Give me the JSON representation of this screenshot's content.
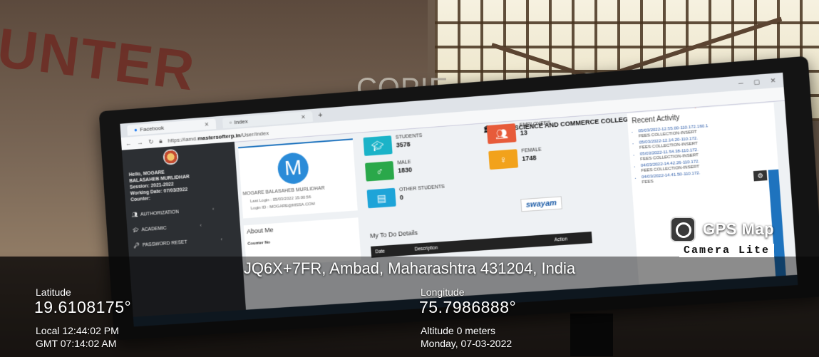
{
  "photo": {
    "wall_sign": "UNTER",
    "wall_sign_2": "COPIE"
  },
  "browser": {
    "tabs": [
      "Facebook",
      "Index"
    ],
    "url_prefix": "https://iamd.",
    "url_domain": "mastersofterp.in",
    "url_path": "/User/Index"
  },
  "app": {
    "college_name": "ARTS,SCIENCE AND COMMERCE COLLEGE, AMBAD",
    "sidebar": {
      "hello": "Hello, MOGARE",
      "user": "BALASAHEB MURLIDHAR",
      "session": "Session: 2021-2022",
      "working_date": "Working Date: 07/03/2022",
      "counter": "Counter:",
      "items": [
        {
          "label": "AUTHORIZATION"
        },
        {
          "label": "ACADEMIC"
        },
        {
          "label": "PASSWORD RESET"
        }
      ]
    },
    "profile": {
      "avatar_letter": "M",
      "name": "MOGARE BALASAHEB MURLIDHAR",
      "last_login": "Last Login : 05/03/2022 15:00:56",
      "login_id": "Login ID : MOGARE@MSSA.COM",
      "about_title": "About Me",
      "counter_no": "Counter No"
    },
    "stats": [
      {
        "label": "STUDENTS",
        "value": "3578",
        "color": "#1bb3c8"
      },
      {
        "label": "EMPLOYEES",
        "value": "13",
        "color": "#e75b3a"
      },
      {
        "label": "MALE",
        "value": "1830",
        "color": "#2aa84a"
      },
      {
        "label": "FEMALE",
        "value": "1748",
        "color": "#f2a21b"
      },
      {
        "label": "OTHER STUDENTS",
        "value": "0",
        "color": "#1ea4d8"
      }
    ],
    "swayam": "swayam",
    "todo": {
      "title": "My To Do Details",
      "columns": [
        "Date",
        "Description",
        "Action"
      ]
    },
    "recent": {
      "title": "Recent Activity",
      "items": [
        {
          "time": "05/03/2022-12.55.00-110.172.160.1",
          "desc": "FEES COLLECTION-INSERT"
        },
        {
          "time": "05/03/2022-12.14.20-110.172.",
          "desc": "FEES COLLECTION-INSERT"
        },
        {
          "time": "05/03/2022-11.54.38-110.172.",
          "desc": "FEES COLLECTION-INSERT"
        },
        {
          "time": "04/03/2022-14.42.26-110.172.",
          "desc": "FEES COLLECTION-INSERT"
        },
        {
          "time": "04/03/2022-14.41.50-110.172.",
          "desc": "FEES"
        }
      ]
    }
  },
  "gps": {
    "brand_title": "GPS Map",
    "brand_sub": "Camera Lite",
    "address": "JQ6X+7FR, Ambad, Maharashtra 431204, India",
    "latitude_label": "Latitude",
    "latitude": "19.6108175°",
    "longitude_label": "Longitude",
    "longitude": "75.7986888°",
    "local_time": "Local 12:44:02 PM",
    "gmt_time": "GMT 07:14:02 AM",
    "altitude": "Altitude 0 meters",
    "date": "Monday, 07-03-2022"
  }
}
